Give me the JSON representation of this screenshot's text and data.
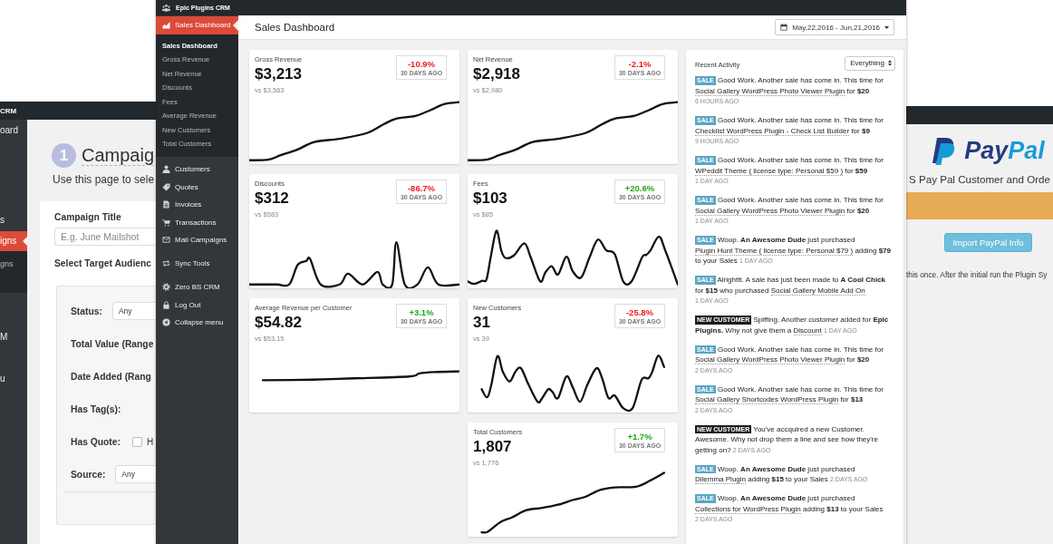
{
  "campaign_window": {
    "app_title": "CRM",
    "sidebar": {
      "items": [
        {
          "label": "oard",
          "selected": false
        },
        {
          "label": "s",
          "selected": false
        },
        {
          "label": "igns",
          "selected": true,
          "children": [
            {
              "label": "gns",
              "selected": false
            }
          ]
        },
        {
          "label": "M",
          "selected": false
        },
        {
          "label": "u",
          "selected": false
        }
      ]
    },
    "step_number": "1",
    "heading": "Campaig",
    "description": "Use this page to sele",
    "form": {
      "title_field": {
        "label": "Campaign Title",
        "placeholder": "E.g. June Mailshot"
      },
      "audience_label": "Select Target Audienc",
      "filters": [
        {
          "label": "Status:",
          "kind": "select",
          "value": "Any"
        },
        {
          "label": "Total Value (Range",
          "kind": "plain"
        },
        {
          "label": "Date Added (Rang",
          "kind": "plain"
        },
        {
          "label": "Has Tag(s):",
          "kind": "plain"
        },
        {
          "label": "Has Quote:",
          "kind": "checkbox",
          "checked": false,
          "option": "H"
        },
        {
          "label": "Source:",
          "kind": "select",
          "value": "Any"
        }
      ]
    }
  },
  "dashboard_window": {
    "app_title": "Epic Plugins CRM",
    "sidebar": {
      "items": [
        {
          "label": "Sales Dashboard",
          "selected": true,
          "children": [
            {
              "label": "Sales Dashboard",
              "selected": true
            },
            {
              "label": "Gross Revenue",
              "selected": false
            },
            {
              "label": "Net Revenue",
              "selected": false
            },
            {
              "label": "Discounts",
              "selected": false
            },
            {
              "label": "Fees",
              "selected": false
            },
            {
              "label": "Average Revenue",
              "selected": false
            },
            {
              "label": "New Customers",
              "selected": false
            },
            {
              "label": "Total Customers",
              "selected": false
            }
          ]
        },
        {
          "label": "Customers",
          "selected": false
        },
        {
          "label": "Quotes",
          "selected": false
        },
        {
          "label": "Invoices",
          "selected": false
        },
        {
          "label": "Transactions",
          "selected": false
        },
        {
          "label": "Mail Campaigns",
          "selected": false
        },
        {
          "label": "Sync Tools",
          "selected": false
        },
        {
          "label": "Zero BS CRM",
          "selected": false
        },
        {
          "label": "Log Out",
          "selected": false
        },
        {
          "label": "Collapse menu",
          "selected": false
        }
      ]
    },
    "header": {
      "title": "Sales Dashboard",
      "date_range": "May,22,2016 - Jun,21,2016"
    },
    "cards": [
      {
        "label": "Gross Revenue",
        "value": "$3,213",
        "comparison": "vs $3,563",
        "change": "-10.9%",
        "color": "#f01c1c",
        "period": "30 DAYS AGO"
      },
      {
        "label": "Net Revenue",
        "value": "$2,918",
        "comparison": "vs $2,980",
        "change": "-2.1%",
        "color": "#f01c1c",
        "period": "30 DAYS AGO"
      },
      {
        "label": "Discounts",
        "value": "$312",
        "comparison": "vs $583",
        "change": "-86.7%",
        "color": "#f01c1c",
        "period": "30 DAYS AGO"
      },
      {
        "label": "Fees",
        "value": "$103",
        "comparison": "vs $85",
        "change": "+20.6%",
        "color": "#22a522",
        "period": "30 DAYS AGO"
      },
      {
        "label": "Average Revenue per Customer",
        "value": "$54.82",
        "comparison": "vs $53.15",
        "change": "+3.1%",
        "color": "#22a522",
        "period": "30 DAYS AGO"
      },
      {
        "label": "New Customers",
        "value": "31",
        "comparison": "vs 39",
        "change": "-25.8%",
        "color": "#f01c1c",
        "period": "30 DAYS AGO"
      },
      {
        "label": "Total Customers",
        "value": "1,807",
        "comparison": "vs 1,776",
        "change": "+1.7%",
        "color": "#22a522",
        "period": "30 DAYS AGO"
      }
    ],
    "activity": {
      "title": "Recent Activity",
      "filter": "Everything",
      "items": [
        {
          "kind": "sale",
          "tag": "SALE",
          "parts": [
            {
              "kind": "text",
              "text": "Good Work. Another sale has come in. This time for"
            },
            {
              "kind": "link",
              "text": "Social Gallery WordPress Photo Viewer Plugin"
            },
            {
              "kind": "text",
              "text": "for **$20**"
            }
          ],
          "time": "6 HOURS AGO"
        },
        {
          "kind": "sale",
          "tag": "SALE",
          "parts": [
            {
              "kind": "text",
              "text": "Good Work. Another sale has come in. This time for"
            },
            {
              "kind": "link",
              "text": "Checklist WordPress Plugin - Check List Builder"
            },
            {
              "kind": "text",
              "text": "for **$9**"
            }
          ],
          "time": "9 HOURS AGO"
        },
        {
          "kind": "sale",
          "tag": "SALE",
          "parts": [
            {
              "kind": "text",
              "text": "Good Work. Another sale has come in. This time for"
            },
            {
              "kind": "link",
              "text": "WPeddit Theme ( license type: Personal $59 )"
            },
            {
              "kind": "text",
              "text": "for **$59**"
            }
          ],
          "time": "1 DAY AGO"
        },
        {
          "kind": "sale",
          "tag": "SALE",
          "parts": [
            {
              "kind": "text",
              "text": "Good Work. Another sale has come in. This time for"
            },
            {
              "kind": "link",
              "text": "Social Gallery WordPress Photo Viewer Plugin"
            },
            {
              "kind": "text",
              "text": "for **$20**"
            }
          ],
          "time": "1 DAY AGO"
        },
        {
          "kind": "sale",
          "tag": "SALE",
          "parts": [
            {
              "kind": "text",
              "text": "Woop. **An Awesome Dude** just purchased"
            },
            {
              "kind": "link",
              "text": "Plugin Hunt Theme ( license type: Personal $79 )"
            },
            {
              "kind": "text",
              "text": "adding **$79** to your Sales"
            }
          ],
          "time": "1 DAY AGO"
        },
        {
          "kind": "sale",
          "tag": "SALE",
          "parts": [
            {
              "kind": "text",
              "text": "Alrighttt. A sale has just been made to **A Cool Chick** for **$15** who purchased"
            },
            {
              "kind": "link",
              "text": "Social Gallery Mobile Add On"
            }
          ],
          "time": "1 DAY AGO"
        },
        {
          "kind": "new_customer",
          "tag": "NEW CUSTOMER",
          "parts": [
            {
              "kind": "text",
              "text": "Spiffing. Another customer added for **Epic Plugins.** Why not give them a"
            },
            {
              "kind": "link",
              "text": "Discount"
            }
          ],
          "time": "1 DAY AGO"
        },
        {
          "kind": "sale",
          "tag": "SALE",
          "parts": [
            {
              "kind": "text",
              "text": "Good Work. Another sale has come in. This time for"
            },
            {
              "kind": "link",
              "text": "Social Gallery WordPress Photo Viewer Plugin"
            },
            {
              "kind": "text",
              "text": "for **$20**"
            }
          ],
          "time": "2 DAYS AGO"
        },
        {
          "kind": "sale",
          "tag": "SALE",
          "parts": [
            {
              "kind": "text",
              "text": "Good Work. Another sale has come in. This time for"
            },
            {
              "kind": "link",
              "text": "Social Gallery Shortcodes WordPress Plugin"
            },
            {
              "kind": "text",
              "text": "for **$13**"
            }
          ],
          "time": "2 DAYS AGO"
        },
        {
          "kind": "new_customer",
          "tag": "NEW CUSTOMER",
          "parts": [
            {
              "kind": "text",
              "text": "You've accquired a new Customer. Awesome. Why not drop them a line and see how they're getting on?"
            }
          ],
          "time": "2 DAYS AGO"
        },
        {
          "kind": "sale",
          "tag": "SALE",
          "parts": [
            {
              "kind": "text",
              "text": "Woop. **An Awesome Dude** just purchased"
            },
            {
              "kind": "link",
              "text": "Dilemma Plugin"
            },
            {
              "kind": "text",
              "text": "adding **$15** to your Sales"
            }
          ],
          "time": "2 DAYS AGO"
        },
        {
          "kind": "sale",
          "tag": "SALE",
          "parts": [
            {
              "kind": "text",
              "text": "Woop. **An Awesome Dude** just purchased"
            },
            {
              "kind": "link",
              "text": "Collections for WordPress Plugin"
            },
            {
              "kind": "text",
              "text": "adding **$13** to your Sales"
            }
          ],
          "time": "2 DAYS AGO"
        }
      ]
    }
  },
  "paypal_window": {
    "logo": "PayPal",
    "subtitle": "S Pay Pal Customer and Orde",
    "button": "Import PayPal Info",
    "note": "this once. After the initial run the Plugin Sy"
  }
}
